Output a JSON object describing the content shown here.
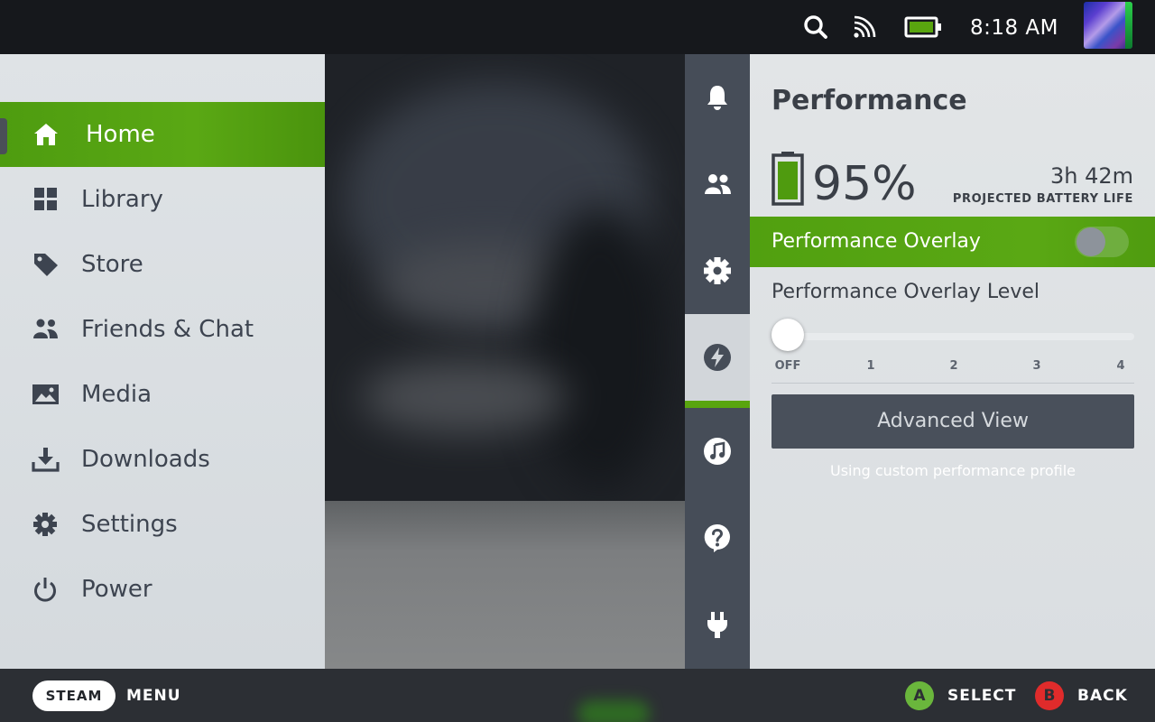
{
  "status_bar": {
    "time": "8:18 AM",
    "icons": [
      "search-icon",
      "wifi-icon",
      "battery-icon",
      "avatar"
    ]
  },
  "main_menu": {
    "items": [
      {
        "label": "Home",
        "icon": "home-icon",
        "active": true
      },
      {
        "label": "Library",
        "icon": "grid-icon"
      },
      {
        "label": "Store",
        "icon": "tag-icon"
      },
      {
        "label": "Friends & Chat",
        "icon": "friends-icon"
      },
      {
        "label": "Media",
        "icon": "image-icon"
      },
      {
        "label": "Downloads",
        "icon": "download-icon"
      },
      {
        "label": "Settings",
        "icon": "gear-icon"
      },
      {
        "label": "Power",
        "icon": "power-icon"
      }
    ]
  },
  "quick_access_tabs": {
    "items": [
      "bell-icon",
      "friends-icon",
      "gear-icon",
      "lightning-icon",
      "music-icon",
      "help-icon",
      "plug-icon"
    ],
    "active": "lightning-icon"
  },
  "performance": {
    "title": "Performance",
    "battery_percent": "95%",
    "battery_level": 0.95,
    "battery_time": "3h 42m",
    "battery_caption": "PROJECTED BATTERY LIFE",
    "overlay_toggle": {
      "label": "Performance Overlay",
      "on": false
    },
    "overlay_level": {
      "label": "Performance Overlay Level",
      "ticks": [
        "OFF",
        "1",
        "2",
        "3",
        "4"
      ],
      "value": "OFF"
    },
    "advanced_button": "Advanced View",
    "profile_note": "Using custom performance profile"
  },
  "bottom_bar": {
    "steam_label": "STEAM",
    "menu_label": "MENU",
    "a_glyph": "A",
    "select_label": "SELECT",
    "b_glyph": "B",
    "back_label": "BACK"
  },
  "colors": {
    "accent_green": "#5aa814",
    "a_button": "#6ab63c",
    "b_button": "#e02b2b",
    "rail": "#464d58"
  }
}
